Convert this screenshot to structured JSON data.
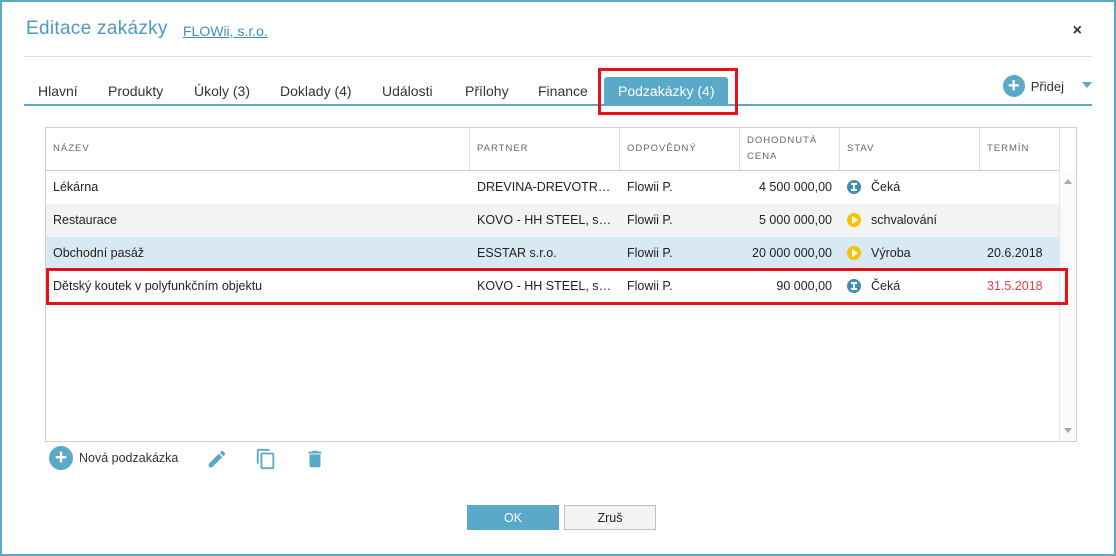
{
  "dialog": {
    "title": "Editace zakázky",
    "company_link": "FLOWii, s.r.o.",
    "close_label": "×"
  },
  "tabs": [
    {
      "label": "Hlavní"
    },
    {
      "label": "Produkty"
    },
    {
      "label": "Úkoly (3)"
    },
    {
      "label": "Doklady (4)"
    },
    {
      "label": "Události"
    },
    {
      "label": "Přílohy"
    },
    {
      "label": "Finance"
    },
    {
      "label": "Podzakázky (4)",
      "active": true
    }
  ],
  "add_menu": {
    "label": "Přidej"
  },
  "table": {
    "columns": [
      "NÁZEV",
      "PARTNER",
      "ODPOVĚDNÝ",
      "DOHODNUTÁ CENA",
      "STAV",
      "TERMÍN"
    ],
    "rows": [
      {
        "name": "Lékárna",
        "partner": "DREVINA-DREVOTRIESKA, s.r.o.",
        "responsible": "Flowii P.",
        "price": "4 500 000,00",
        "status": "Čeká",
        "status_icon": "hourglass-icon",
        "deadline": ""
      },
      {
        "name": "Restaurace",
        "partner": "KOVO - HH STEEL, s.r.o.",
        "responsible": "Flowii P.",
        "price": "5 000 000,00",
        "status": "schvalování",
        "status_icon": "play-icon",
        "deadline": ""
      },
      {
        "name": "Obchodní pasáž",
        "partner": "ESSTAR s.r.o.",
        "responsible": "Flowii P.",
        "price": "20 000 000,00",
        "status": "Výroba",
        "status_icon": "play-icon",
        "deadline": "20.6.2018"
      },
      {
        "name": "Dětský koutek v polyfunkčním objektu",
        "partner": "KOVO - HH STEEL, s.r.o.",
        "responsible": "Flowii P.",
        "price": "90 000,00",
        "status": "Čeká",
        "status_icon": "hourglass-icon",
        "deadline": "31.5.2018",
        "deadline_overdue": true
      }
    ]
  },
  "toolbar": {
    "new_label": "Nová podzakázka",
    "icons": [
      "pencil-icon",
      "copy-icon",
      "trash-icon"
    ]
  },
  "footer": {
    "ok_label": "OK",
    "cancel_label": "Zruš"
  },
  "colors": {
    "accent": "#5aa9c9",
    "highlight": "#e8101a",
    "overdue": "#e0404a",
    "waiting": "#3d8fb5",
    "in_progress": "#f5c400"
  }
}
